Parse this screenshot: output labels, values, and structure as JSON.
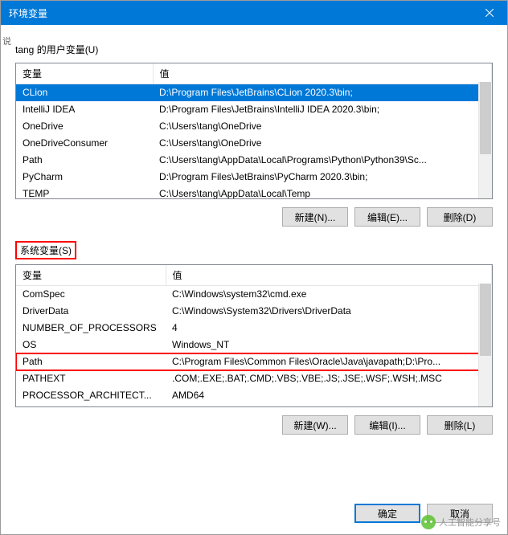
{
  "window": {
    "title": "环境变量"
  },
  "user": {
    "section_label": "tang 的用户变量(U)",
    "col_var": "变量",
    "col_val": "值",
    "rows": [
      {
        "name": "CLion",
        "value": "D:\\Program Files\\JetBrains\\CLion 2020.3\\bin;",
        "selected": true
      },
      {
        "name": "IntelliJ IDEA",
        "value": "D:\\Program Files\\JetBrains\\IntelliJ IDEA 2020.3\\bin;",
        "selected": false
      },
      {
        "name": "OneDrive",
        "value": "C:\\Users\\tang\\OneDrive",
        "selected": false
      },
      {
        "name": "OneDriveConsumer",
        "value": "C:\\Users\\tang\\OneDrive",
        "selected": false
      },
      {
        "name": "Path",
        "value": "C:\\Users\\tang\\AppData\\Local\\Programs\\Python\\Python39\\Sc...",
        "selected": false
      },
      {
        "name": "PyCharm",
        "value": "D:\\Program Files\\JetBrains\\PyCharm 2020.3\\bin;",
        "selected": false
      },
      {
        "name": "TEMP",
        "value": "C:\\Users\\tang\\AppData\\Local\\Temp",
        "selected": false
      }
    ],
    "btn_new": "新建(N)...",
    "btn_edit": "编辑(E)...",
    "btn_delete": "删除(D)"
  },
  "system": {
    "section_label": "系统变量(S)",
    "col_var": "变量",
    "col_val": "值",
    "rows": [
      {
        "name": "ComSpec",
        "value": "C:\\Windows\\system32\\cmd.exe",
        "hl": false
      },
      {
        "name": "DriverData",
        "value": "C:\\Windows\\System32\\Drivers\\DriverData",
        "hl": false
      },
      {
        "name": "NUMBER_OF_PROCESSORS",
        "value": "4",
        "hl": false
      },
      {
        "name": "OS",
        "value": "Windows_NT",
        "hl": false
      },
      {
        "name": "Path",
        "value": "C:\\Program Files\\Common Files\\Oracle\\Java\\javapath;D:\\Pro...",
        "hl": true
      },
      {
        "name": "PATHEXT",
        "value": ".COM;.EXE;.BAT;.CMD;.VBS;.VBE;.JS;.JSE;.WSF;.WSH;.MSC",
        "hl": false
      },
      {
        "name": "PROCESSOR_ARCHITECT...",
        "value": "AMD64",
        "hl": false
      }
    ],
    "btn_new": "新建(W)...",
    "btn_edit": "编辑(I)...",
    "btn_delete": "删除(L)"
  },
  "dialog": {
    "ok": "确定",
    "cancel": "取消"
  },
  "watermark": "人工智能分享号",
  "side_hint": "说"
}
